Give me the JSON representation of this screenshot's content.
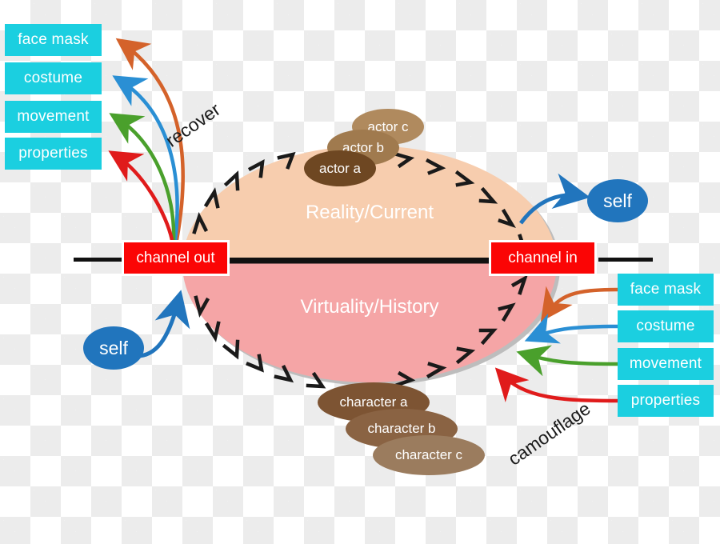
{
  "diagram": {
    "title_top_half": "Reality/Current",
    "title_bottom_half": "Virtuality/History",
    "channel_out": "channel out",
    "channel_in": "channel in",
    "self_left": "self",
    "self_right": "self",
    "recover_label": "recover",
    "camouflage_label": "camouflage"
  },
  "left_tags": [
    {
      "label": "face mask",
      "arrow_color": "#d4622a"
    },
    {
      "label": "costume",
      "arrow_color": "#2a8fd4"
    },
    {
      "label": "movement",
      "arrow_color": "#4aa02c"
    },
    {
      "label": "properties",
      "arrow_color": "#e01b1b"
    }
  ],
  "right_tags": [
    {
      "label": "face mask",
      "arrow_color": "#d4622a"
    },
    {
      "label": "costume",
      "arrow_color": "#2a8fd4"
    },
    {
      "label": "movement",
      "arrow_color": "#4aa02c"
    },
    {
      "label": "properties",
      "arrow_color": "#e01b1b"
    }
  ],
  "actors": [
    {
      "label": "actor c",
      "color": "#b08a5e"
    },
    {
      "label": "actor b",
      "color": "#a07a4e"
    },
    {
      "label": "actor a",
      "color": "#6e4722"
    }
  ],
  "characters": [
    {
      "label": "character a",
      "color": "#7d5433"
    },
    {
      "label": "character b",
      "color": "#8a6343"
    },
    {
      "label": "character c",
      "color": "#9b7c5e"
    }
  ],
  "colors": {
    "tag_box": "#1bcfe0",
    "channel_box": "#fb0505",
    "self_oval": "#2175bd",
    "reality_half": "#f7cdae",
    "virtuality_half": "#f5a5a6",
    "ellipse_shadow": "#b9b9b9",
    "divider_line": "#111111",
    "chevron": "#1a1a1a"
  }
}
